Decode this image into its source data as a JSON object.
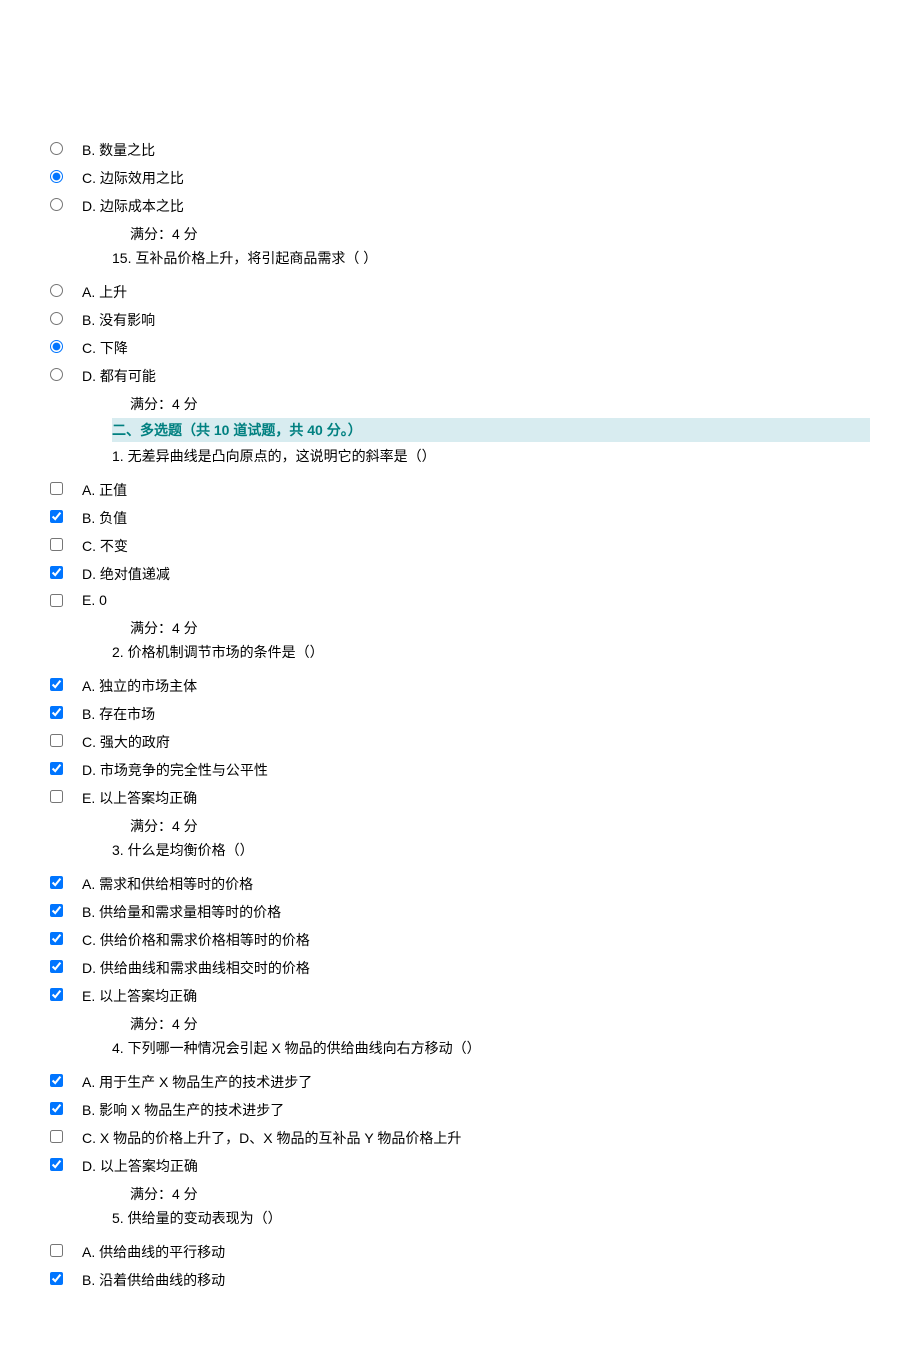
{
  "q14_tail": {
    "options": [
      {
        "label": "B.  数量之比",
        "checked": false
      },
      {
        "label": "C.  边际效用之比",
        "checked": true
      },
      {
        "label": "D.  边际成本之比",
        "checked": false
      }
    ],
    "score": "满分：4  分"
  },
  "q15": {
    "text": "15.  互补品价格上升，将引起商品需求（  ）",
    "options": [
      {
        "label": "A.  上升",
        "checked": false
      },
      {
        "label": "B.  没有影响",
        "checked": false
      },
      {
        "label": "C.  下降",
        "checked": true
      },
      {
        "label": "D.  都有可能",
        "checked": false
      }
    ],
    "score": "满分：4  分"
  },
  "section2": {
    "heading": "二、多选题（共 10 道试题，共 40 分。）"
  },
  "m1": {
    "text": "1.  无差异曲线是凸向原点的，这说明它的斜率是（）",
    "options": [
      {
        "label": "A.  正值",
        "checked": false
      },
      {
        "label": "B.  负值",
        "checked": true
      },
      {
        "label": "C.  不变",
        "checked": false
      },
      {
        "label": "D.  绝对值递减",
        "checked": true
      },
      {
        "label": "E. 0",
        "checked": false
      }
    ],
    "score": "满分：4  分"
  },
  "m2": {
    "text": "2.  价格机制调节市场的条件是（）",
    "options": [
      {
        "label": "A.  独立的市场主体",
        "checked": true
      },
      {
        "label": "B.  存在市场",
        "checked": true
      },
      {
        "label": "C.  强大的政府",
        "checked": false
      },
      {
        "label": "D.  市场竞争的完全性与公平性",
        "checked": true
      },
      {
        "label": "E.  以上答案均正确",
        "checked": false
      }
    ],
    "score": "满分：4  分"
  },
  "m3": {
    "text": "3.  什么是均衡价格（）",
    "options": [
      {
        "label": "A.  需求和供给相等时的价格",
        "checked": true
      },
      {
        "label": "B.  供给量和需求量相等时的价格",
        "checked": true
      },
      {
        "label": "C.  供给价格和需求价格相等时的价格",
        "checked": true
      },
      {
        "label": "D.  供给曲线和需求曲线相交时的价格",
        "checked": true
      },
      {
        "label": "E.  以上答案均正确",
        "checked": true
      }
    ],
    "score": "满分：4  分"
  },
  "m4": {
    "text": "4.  下列哪一种情况会引起 X 物品的供给曲线向右方移动（）",
    "options": [
      {
        "label": "A.  用于生产 X 物品生产的技术进步了",
        "checked": true
      },
      {
        "label": "B.  影响 X 物品生产的技术进步了",
        "checked": true
      },
      {
        "label": "C. X 物品的价格上升了，D、X 物品的互补品 Y 物品价格上升",
        "checked": false
      },
      {
        "label": "D.  以上答案均正确",
        "checked": true
      }
    ],
    "score": "满分：4  分"
  },
  "m5": {
    "text": "5.  供给量的变动表现为（）",
    "options": [
      {
        "label": "A.  供给曲线的平行移动",
        "checked": false
      },
      {
        "label": "B.  沿着供给曲线的移动",
        "checked": true
      }
    ]
  }
}
